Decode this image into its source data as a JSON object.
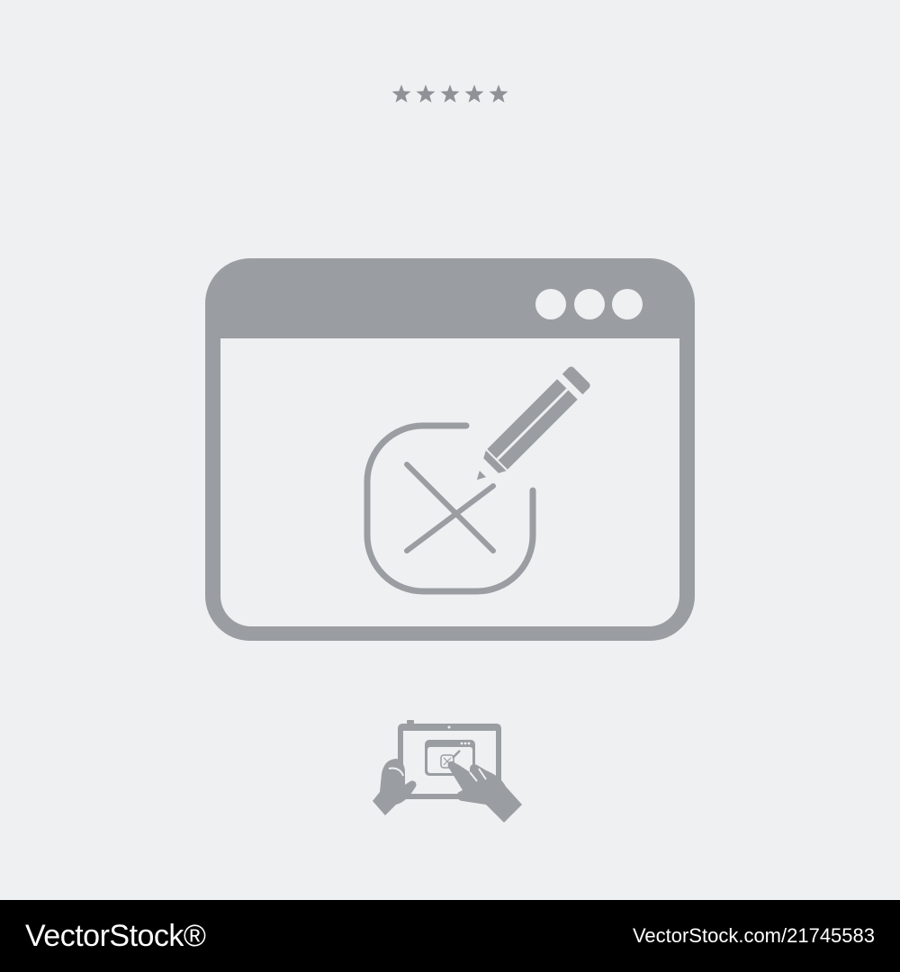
{
  "rating": {
    "stars": 5,
    "color": "#8e9196"
  },
  "icon": {
    "name": "edit-delete-window",
    "color": "#9a9da1",
    "background": "#eef0f2",
    "window_dots": 3
  },
  "footer": {
    "logo": "VectorStock®",
    "image_id": "VectorStock.com/21745583"
  }
}
